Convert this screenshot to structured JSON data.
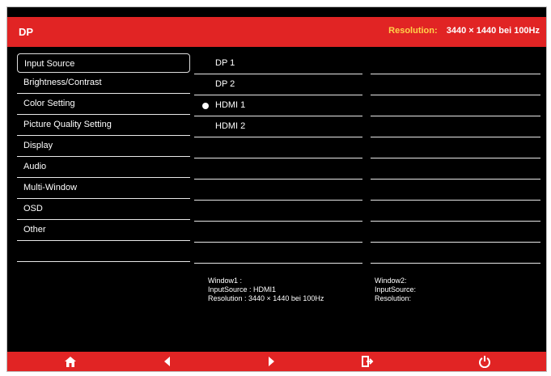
{
  "header": {
    "title": "DP",
    "resolution_label": "Resolution:",
    "resolution_value": "3440 × 1440 bei 100Hz"
  },
  "menu": {
    "items": [
      {
        "label": "Input Source",
        "selected": true
      },
      {
        "label": "Brightness/Contrast"
      },
      {
        "label": "Color Setting"
      },
      {
        "label": "Picture Quality Setting"
      },
      {
        "label": "Display"
      },
      {
        "label": "Audio"
      },
      {
        "label": "Multi-Window"
      },
      {
        "label": "OSD"
      },
      {
        "label": "Other"
      }
    ]
  },
  "sources": {
    "items": [
      {
        "label": "DP 1",
        "active": false
      },
      {
        "label": "DP 2",
        "active": false
      },
      {
        "label": "HDMI 1",
        "active": true
      },
      {
        "label": "HDMI 2",
        "active": false
      }
    ]
  },
  "window1": {
    "title": "Window1 :",
    "input": "InputSource : HDMI1",
    "resolution": "Resolution : 3440 × 1440 bei 100Hz"
  },
  "window2": {
    "title": "Window2:",
    "input": "InputSource:",
    "resolution": "Resolution:"
  },
  "bottom_bar": {
    "icons": [
      "home-icon",
      "left-arrow-icon",
      "right-arrow-icon",
      "exit-icon",
      "power-icon"
    ]
  },
  "colors": {
    "accent": "#e12424",
    "label_yellow": "#ffd24a",
    "background": "#000000",
    "text": "#ffffff"
  }
}
